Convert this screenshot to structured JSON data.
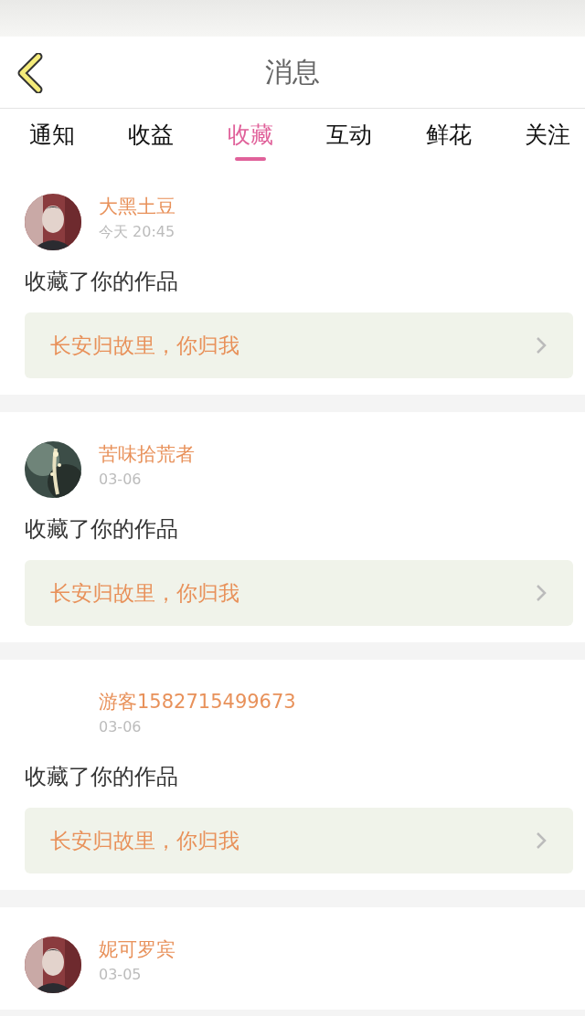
{
  "header": {
    "title": "消息"
  },
  "tabs": [
    {
      "label": "通知",
      "selected": false
    },
    {
      "label": "收益",
      "selected": false
    },
    {
      "label": "收藏",
      "selected": true
    },
    {
      "label": "互动",
      "selected": false
    },
    {
      "label": "鲜花",
      "selected": false
    },
    {
      "label": "关注",
      "selected": false
    }
  ],
  "messages": [
    {
      "name": "大黑土豆",
      "time": "今天 20:45",
      "action": "收藏了你的作品",
      "work": "长安归故里，你归我"
    },
    {
      "name": "苦味拾荒者",
      "time": "03-06",
      "action": "收藏了你的作品",
      "work": "长安归故里，你归我"
    },
    {
      "name": "游客1582715499673",
      "time": "03-06",
      "action": "收藏了你的作品",
      "work": "长安归故里，你归我"
    },
    {
      "name": "妮可罗宾",
      "time": "03-05"
    }
  ]
}
